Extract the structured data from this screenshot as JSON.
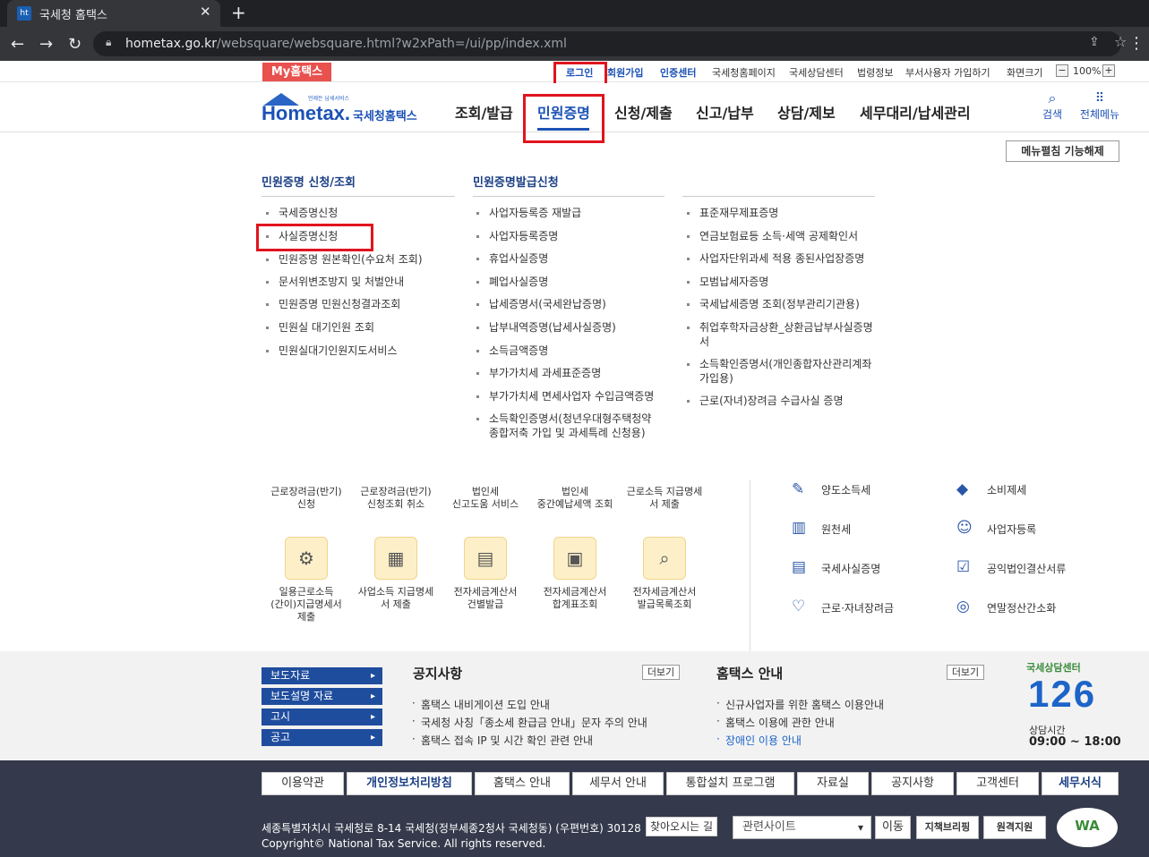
{
  "browser": {
    "tab_title": "국세청 홈택스",
    "url_host": "hometax.go.kr",
    "url_path": "/websquare/websquare.html?w2xPath=/ui/pp/index.xml"
  },
  "util": {
    "my": "My홈택스",
    "login": "로그인",
    "join": "회원가입",
    "cert": "인증센터",
    "links": [
      "국세청홈페이지",
      "국세상담센터",
      "법령정보",
      "부서사용자 가입하기"
    ],
    "screen_size": "화면크기",
    "zoom": "100%"
  },
  "header": {
    "logo_small": "언제든 납세서비스",
    "logo_main": "Hometax.",
    "logo_sub": "국세청홈택스",
    "gnb": [
      "조회/발급",
      "민원증명",
      "신청/제출",
      "신고/납부",
      "상담/제보",
      "세무대리/납세관리"
    ],
    "search": "검색",
    "all_menu": "전체메뉴"
  },
  "megamenu": {
    "toggle": "메뉴펼침 기능해제",
    "col1": {
      "title": "민원증명 신청/조회",
      "items": [
        "국세증명신청",
        "사실증명신청",
        "민원증명 원본확인(수요처 조회)",
        "문서위변조방지 및 처벌안내",
        "민원증명 민원신청결과조회",
        "민원실 대기인원 조회",
        "민원실대기인원지도서비스"
      ]
    },
    "col2": {
      "title": "민원증명발급신청",
      "items": [
        "사업자등록증 재발급",
        "사업자등록증명",
        "휴업사실증명",
        "폐업사실증명",
        "납세증명서(국세완납증명)",
        "납부내역증명(납세사실증명)",
        "소득금액증명",
        "부가가치세 과세표준증명",
        "부가가치세 면세사업자 수입금액증명",
        "소득확인증명서(청년우대형주택청약 종합저축 가입 및 과세특례 신청용)"
      ]
    },
    "col3": {
      "items": [
        "표준재무제표증명",
        "연금보험료등 소득·세액 공제확인서",
        "사업자단위과세 적용 종된사업장증명",
        "모범납세자증명",
        "국세납세증명 조회(정부관리기관용)",
        "취업후학자금상환_상환금납부사실증명서",
        "소득확인증명서(개인종합자산관리계좌 가입용)",
        "근로(자녀)장려금 수급사실 증명"
      ]
    }
  },
  "quick": {
    "row1": [
      "근로장려금(반기)\n신청",
      "근로장려금(반기)\n신청조회 취소",
      "법인세\n신고도움 서비스",
      "법인세\n중간예납세액 조회",
      "근로소득 지급명세\n서 제출"
    ],
    "row2": [
      "일용근로소득\n(간이)지급명세서\n제출",
      "사업소득 지급명세\n서 제출",
      "전자세금계산서\n건별발급",
      "전자세금계산서\n합계표조회",
      "전자세금계산서\n발급목록조회"
    ],
    "right": [
      "양도소득세",
      "소비제세",
      "원천세",
      "사업자등록",
      "국세사실증명",
      "공익법인결산서류",
      "근로·자녀장려금",
      "연말정산간소화"
    ]
  },
  "notice": {
    "press": [
      "보도자료",
      "보도설명 자료",
      "고시",
      "공고"
    ],
    "notice_title": "공지사항",
    "more": "더보기",
    "notice_items": [
      "홈택스 내비게이션 도입 안내",
      "국세청 사칭「종소세 환급금 안내」문자 주의 안내",
      "홈택스 접속 IP 및 시간 확인 관련 안내"
    ],
    "guide_title": "홈택스 안내",
    "guide_items": [
      "신규사업자를 위한 홈택스 이용안내",
      "홈택스 이용에 관한 안내",
      "장애인 이용 안내"
    ],
    "center_label": "국세상담센터",
    "center_number": "126",
    "hours_label": "상담시간",
    "hours": "09:00 ~ 18:00"
  },
  "footer": {
    "links": [
      "이용약관",
      "개인정보처리방침",
      "홈택스 안내",
      "세무서 안내",
      "통합설치 프로그램",
      "자료실",
      "공지사항",
      "고객센터",
      "세무서식"
    ],
    "address": "세종특별자치시 국세청로 8-14 국세청(정부세종2청사 국세청동) (우편번호) 30128",
    "find_way": "찾아오시는 길",
    "copyright": "Copyright© National Tax Service. All rights reserved.",
    "related": "관련사이트",
    "go": "이동",
    "badge1": "지책브리핑",
    "badge2": "원격지원",
    "wa": "WA"
  }
}
